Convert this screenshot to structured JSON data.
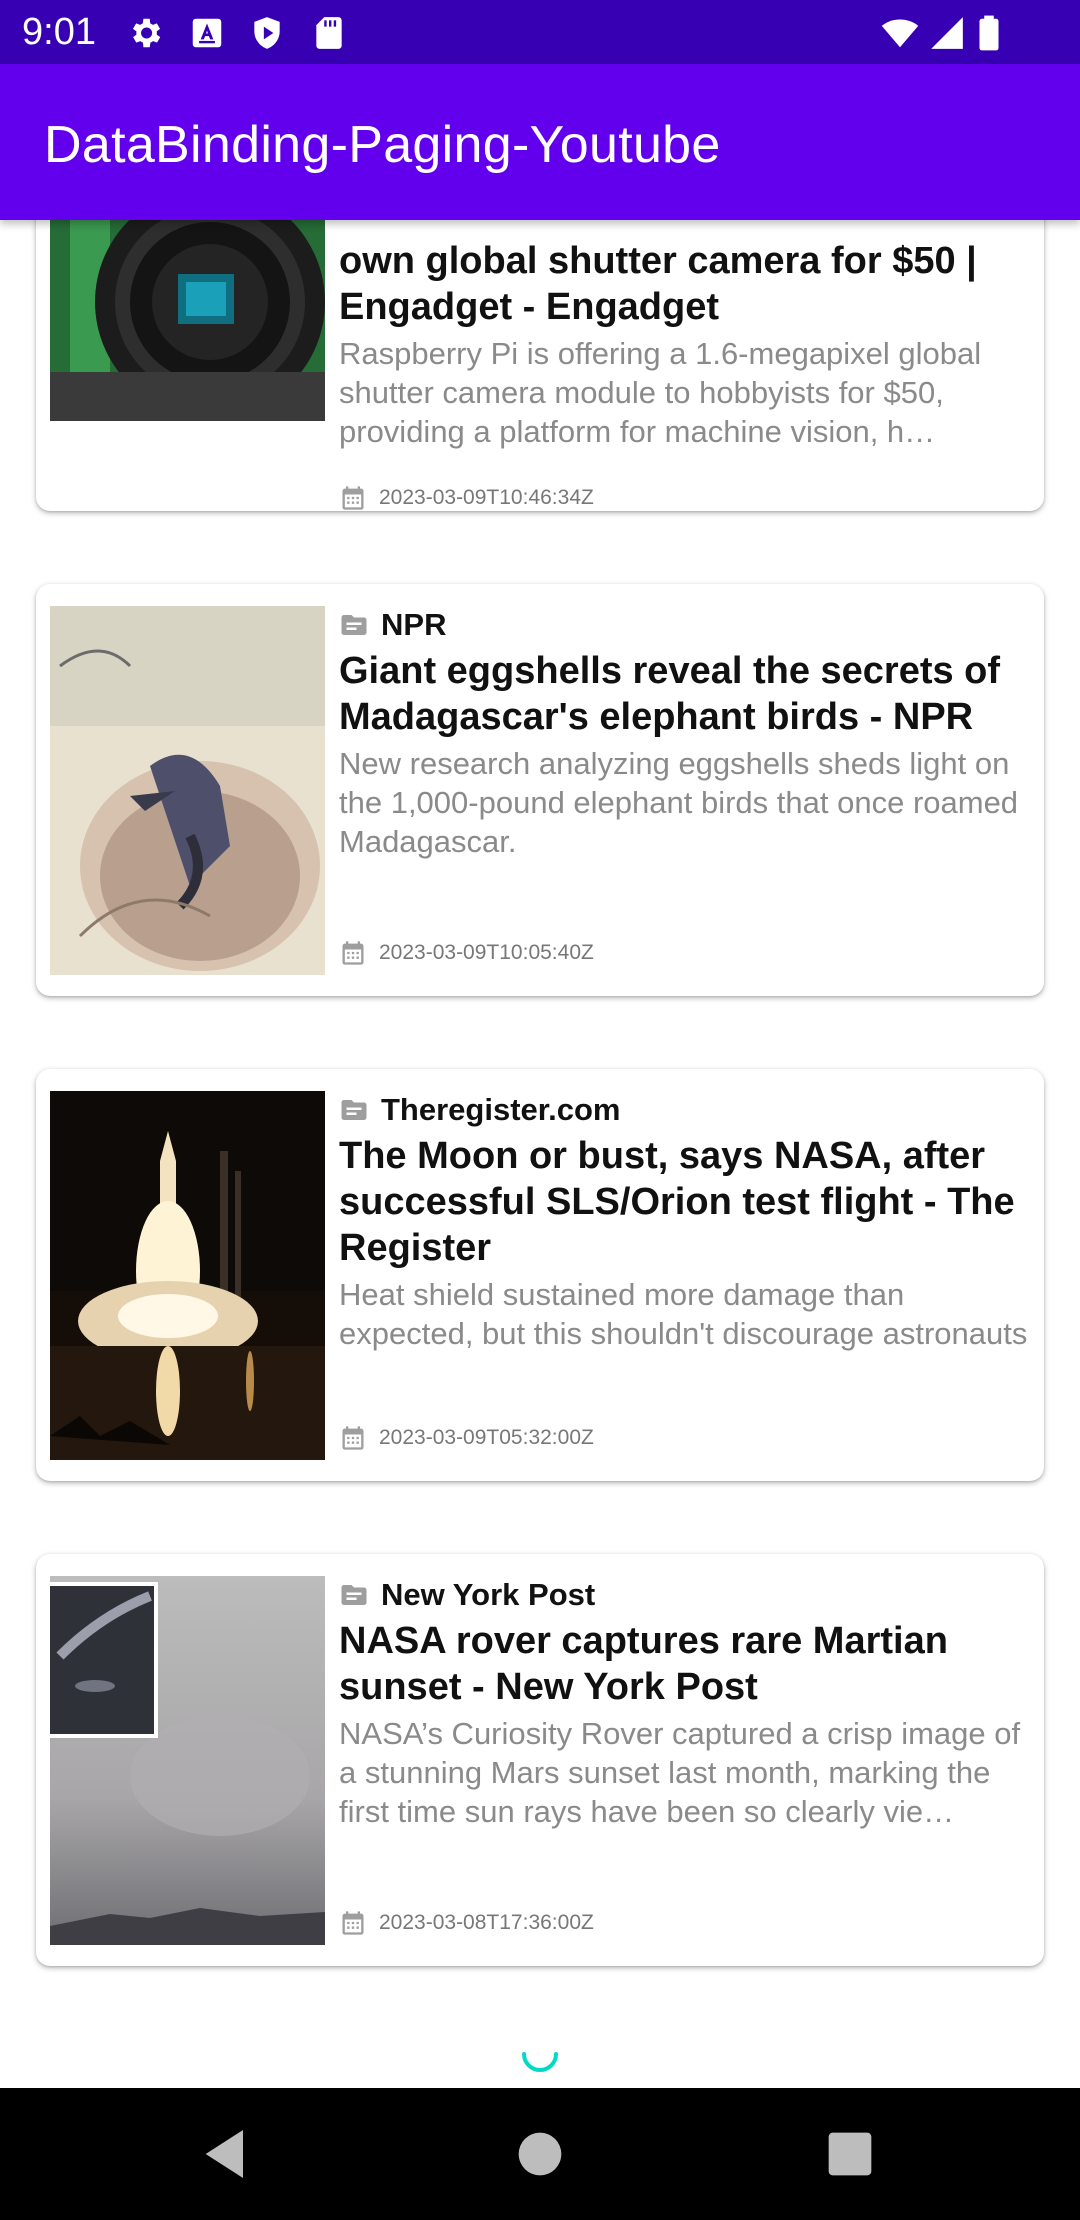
{
  "status_bar": {
    "time": "9:01",
    "left_icons": [
      "settings-icon",
      "text-a-icon",
      "shield-play-icon",
      "sd-card-icon"
    ],
    "right_icons": [
      "wifi-icon",
      "signal-icon",
      "battery-icon"
    ]
  },
  "app_bar": {
    "title": "DataBinding-Paging-Youtube",
    "color": "#6200ee",
    "status_color": "#3700b3"
  },
  "articles": [
    {
      "source": "",
      "title": "own global shutter camera for $50 | Engadget - Engadget",
      "description": "Raspberry Pi is offering a 1.6-megapixel global shutter camera module to hobbyists for $50, providing a platform for machine vision, h…",
      "published_at": "2023-03-09T10:46:34Z",
      "image": "camera-module-photo"
    },
    {
      "source": "NPR",
      "title": "Giant eggshells reveal the secrets of Madagascar's elephant birds - NPR",
      "description": "New research analyzing eggshells sheds light on the 1,000-pound elephant birds that once roamed Madagascar.",
      "published_at": "2023-03-09T10:05:40Z",
      "image": "hatching-bird-illustration"
    },
    {
      "source": "Theregister.com",
      "title": "The Moon or bust, says NASA, after successful SLS/Orion test flight - The Register",
      "description": "Heat shield sustained more damage than expected, but this shouldn't discourage astronauts",
      "published_at": "2023-03-09T05:32:00Z",
      "image": "rocket-launch-photo"
    },
    {
      "source": "New York Post",
      "title": "NASA rover captures rare Martian sunset - New York Post",
      "description": "NASA’s Curiosity Rover captured a crisp image of a stunning Mars sunset last month, marking the first time sun rays have been so clearly vie…",
      "published_at": "2023-03-08T17:36:00Z",
      "image": "mars-sunset-photo"
    }
  ],
  "accent_color": "#03dac5",
  "nav_bar": {
    "buttons": [
      "back-icon",
      "home-icon",
      "recents-icon"
    ]
  }
}
